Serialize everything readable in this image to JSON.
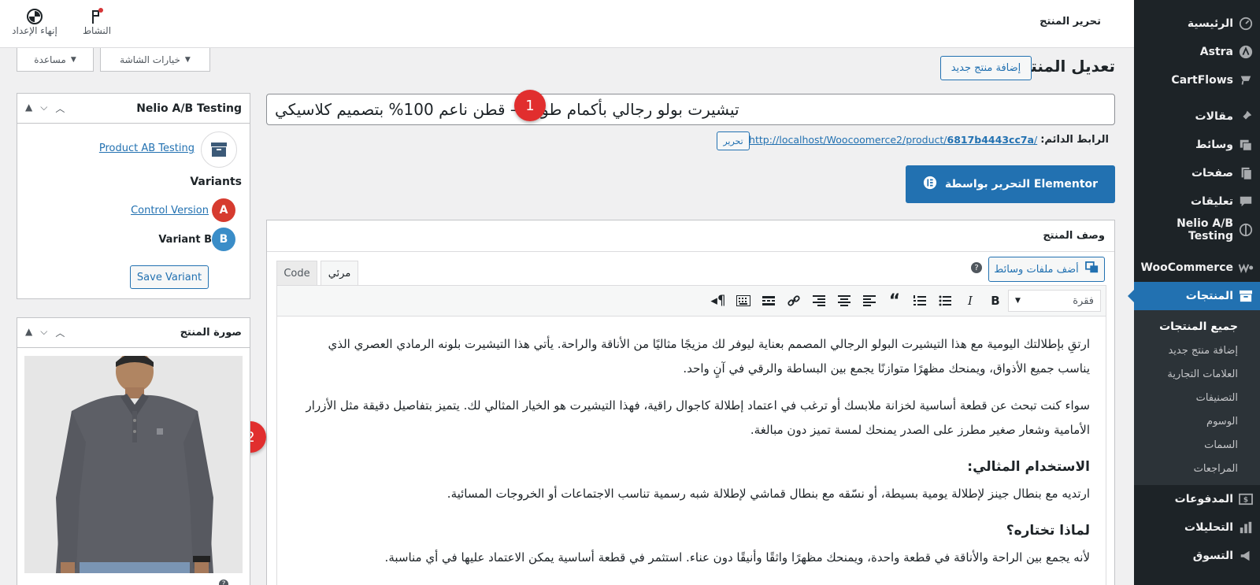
{
  "sidebar": {
    "items": [
      {
        "label": "الرئيسية",
        "icon": "dashboard-icon"
      },
      {
        "label": "Astra",
        "icon": "astra-icon"
      },
      {
        "label": "CartFlows",
        "icon": "cartflows-icon"
      },
      {
        "label": "مقالات",
        "icon": "pin-icon"
      },
      {
        "label": "وسائط",
        "icon": "media-icon"
      },
      {
        "label": "صفحات",
        "icon": "pages-icon"
      },
      {
        "label": "تعليقات",
        "icon": "comments-icon"
      },
      {
        "label": "Nelio A/B Testing",
        "icon": "nelio-icon"
      },
      {
        "label": "WooCommerce",
        "icon": "woocommerce-icon"
      },
      {
        "label": "المنتجات",
        "icon": "products-icon"
      },
      {
        "label": "المدفوعات",
        "icon": "payments-icon"
      },
      {
        "label": "التحليلات",
        "icon": "analytics-icon"
      },
      {
        "label": "التسوق",
        "icon": "marketing-icon"
      }
    ],
    "submenu": [
      "جميع المنتجات",
      "إضافة منتج جديد",
      "العلامات التجارية",
      "التصنيفات",
      "الوسوم",
      "السمات",
      "المراجعات"
    ]
  },
  "topbar": {
    "page_label": "تحرير المنتج",
    "activity": "النشاط",
    "finish_setup": "إنهاء الإعداد"
  },
  "screen_meta": {
    "screen_options": "خيارات الشاشة",
    "help": "مساعدة"
  },
  "header": {
    "title": "تعديل المنتج",
    "add_new": "إضافة منتج جديد"
  },
  "product": {
    "title": "تيشيرت بولو رجالي بأكمام طويلة – قطن ناعم 100% بتصميم كلاسيكي",
    "permalink_label": "الرابط الدائم:",
    "permalink_base": "http://localhost/Woocoomerce2/product/",
    "permalink_slug": "6817b4443cc7a",
    "permalink_end": "/",
    "edit_slug": "تحرير",
    "elementor_btn": "التحرير بواسطة Elementor"
  },
  "description": {
    "box_title": "وصف المنتج",
    "add_media": "أضف ملفات وسائط",
    "tab_visual": "مرئي",
    "tab_code": "Code",
    "format_select": "فقرة",
    "paragraphs": [
      "ارتقِ بإطلالتك اليومية مع هذا التيشيرت البولو الرجالي المصمم بعناية ليوفر لك مزيجًا مثاليًا من الأناقة والراحة. يأتي هذا التيشيرت بلونه الرمادي العصري الذي يناسب جميع الأذواق، ويمنحك مظهرًا متوازنًا يجمع بين البساطة والرقي في آنٍ واحد.",
      "سواء كنت تبحث عن قطعة أساسية لخزانة ملابسك أو ترغب في اعتماد إطلالة كاجوال راقية، فهذا التيشيرت هو الخيار المثالي لك. يتميز بتفاصيل دقيقة مثل الأزرار الأمامية وشعار صغير مطرز على الصدر يمنحك لمسة تميز دون مبالغة."
    ],
    "heading1": "الاستخدام المثالي:",
    "para3": "ارتديه مع بنطال جينز لإطلالة يومية بسيطة، أو نسّقه مع بنطال قماشي لإطلالة شبه رسمية تناسب الاجتماعات أو الخروجات المسائية.",
    "heading2": "لماذا تختاره؟",
    "para4": "لأنه يجمع بين الراحة والأناقة في قطعة واحدة، ويمنحك مظهرًا واثقًا وأنيقًا دون عناء. استثمر في قطعة أساسية يمكن الاعتماد عليها في أي مناسبة."
  },
  "nelio": {
    "title": "Nelio A/B Testing",
    "test_link": "Product AB Testing",
    "variants_label": "Variants",
    "control": "Control Version",
    "variant_b": "Variant B",
    "badge_a": "A",
    "badge_b": "B",
    "save": "Save Variant"
  },
  "product_image": {
    "title": "صورة المنتج"
  },
  "callouts": [
    "1",
    "2"
  ],
  "colors": {
    "sidebar_bg": "#1d2327",
    "active": "#2271b1",
    "elementor": "#2271b1",
    "callout": "#e12e2e",
    "badge_a": "#d63b2f",
    "badge_b": "#3a8dc8"
  }
}
